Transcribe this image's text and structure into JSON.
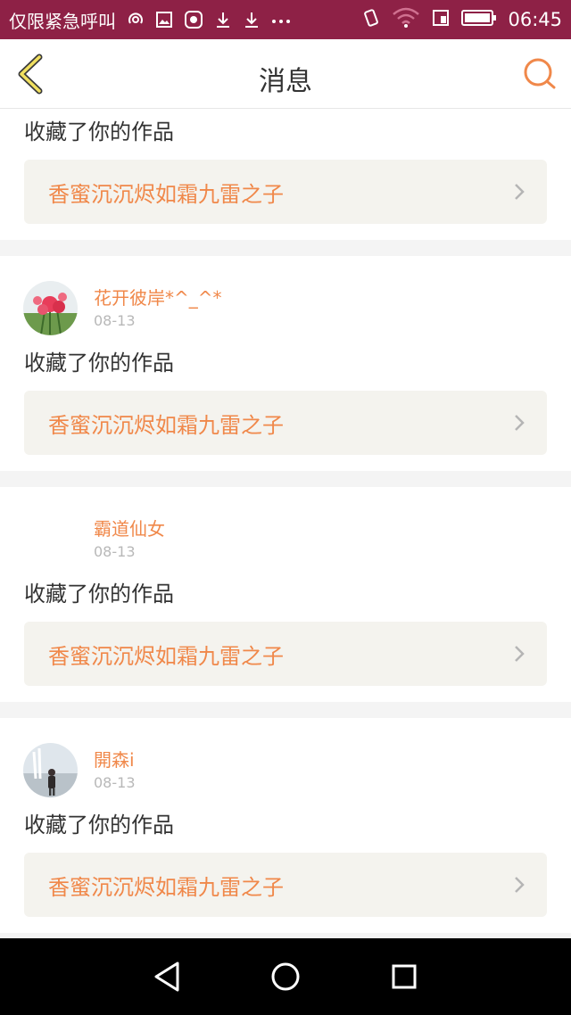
{
  "status_bar": {
    "carrier": "仅限紧急呼叫",
    "time": "06:45",
    "icons": [
      "hotspot-icon",
      "image-icon",
      "app-icon",
      "download-icon",
      "download-icon",
      "more-dots-icon",
      "vibrate-icon",
      "wifi-icon",
      "sim-icon",
      "battery-icon"
    ]
  },
  "header": {
    "title": "消息",
    "back_icon": "chevron-left-icon",
    "search_icon": "search-icon",
    "accent": "#f0884a"
  },
  "messages": [
    {
      "action": "收藏了你的作品",
      "work": "香蜜沉沉烬如霜九雷之子"
    },
    {
      "username": "花开彼岸*^_^*",
      "date": "08-13",
      "action": "收藏了你的作品",
      "work": "香蜜沉沉烬如霜九雷之子"
    },
    {
      "username": "霸道仙女",
      "date": "08-13",
      "action": "收藏了你的作品",
      "work": "香蜜沉沉烬如霜九雷之子"
    },
    {
      "username": "開森i",
      "date": "08-13",
      "action": "收藏了你的作品",
      "work": "香蜜沉沉烬如霜九雷之子"
    }
  ],
  "nav_bar": {
    "icons": [
      "back-triangle-icon",
      "home-circle-icon",
      "recents-square-icon"
    ]
  }
}
